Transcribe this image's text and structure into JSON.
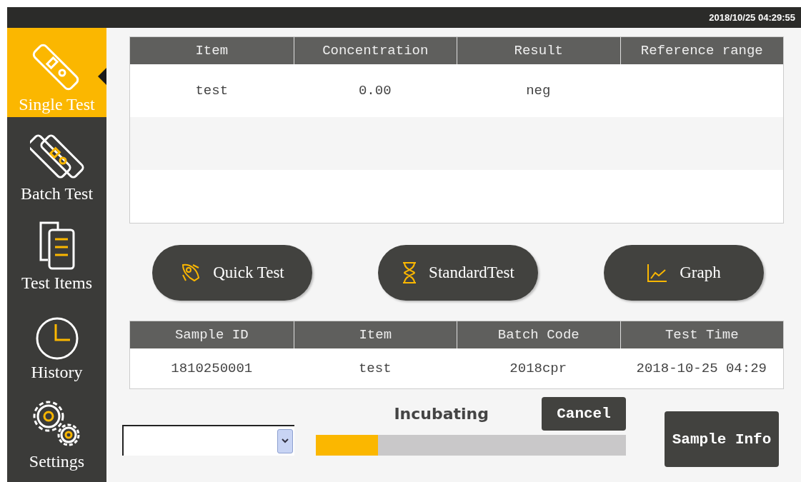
{
  "status_bar": {
    "datetime": "2018/10/25 04:29:55"
  },
  "sidebar": {
    "items": [
      {
        "label": "Single Test",
        "kind": "strip",
        "selected": true
      },
      {
        "label": "Batch Test",
        "kind": "strips",
        "selected": false
      },
      {
        "label": "Test Items",
        "kind": "list",
        "selected": false
      },
      {
        "label": "History",
        "kind": "clock",
        "selected": false
      },
      {
        "label": "Settings",
        "kind": "gears",
        "selected": false
      }
    ]
  },
  "results_table": {
    "columns": [
      "Item",
      "Concentration",
      "Result",
      "Reference range"
    ],
    "rows": [
      [
        "test",
        "0.00",
        "neg",
        ""
      ]
    ]
  },
  "actions": [
    {
      "label": "Quick Test",
      "kind": "rocket"
    },
    {
      "label": "StandardTest",
      "kind": "hourglass"
    },
    {
      "label": "Graph",
      "kind": "chart"
    }
  ],
  "sample_table": {
    "columns": [
      "Sample ID",
      "Item",
      "Batch Code",
      "Test Time"
    ],
    "rows": [
      [
        "1810250001",
        "test",
        "2018cpr",
        "2018-10-25 04:29"
      ]
    ]
  },
  "progress": {
    "label": "Incubating",
    "level": 0.2
  },
  "cancel_button": "Cancel",
  "sample_info_button": "Sample Info"
}
